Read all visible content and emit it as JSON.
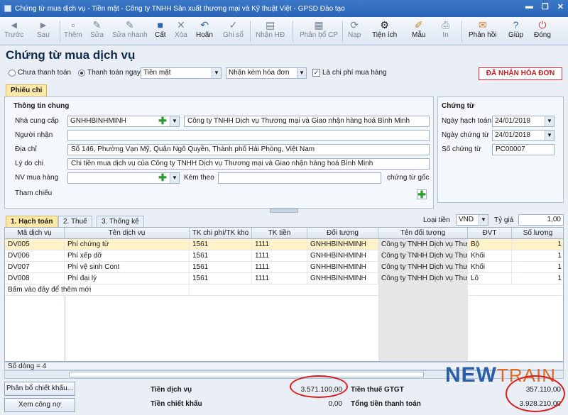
{
  "window": {
    "title": "Chứng từ mua dịch vụ - Tiền mặt - Công ty TNHH Sản xuất thương mại và Kỹ thuật Việt - GPSD Đào tạo",
    "controls": [
      "▬",
      "❐",
      "✕"
    ]
  },
  "toolbar": {
    "items": [
      {
        "label": "Trước",
        "icon": "◄"
      },
      {
        "label": "Sau",
        "icon": "►"
      },
      {
        "label": "Thêm",
        "icon": "▫"
      },
      {
        "label": "Sửa",
        "icon": "✎"
      },
      {
        "label": "Sửa nhanh",
        "icon": "✎"
      },
      {
        "label": "Cất",
        "icon": "■"
      },
      {
        "label": "Xóa",
        "icon": "✕"
      },
      {
        "label": "Hoãn",
        "icon": "↶"
      },
      {
        "label": "Ghi sổ",
        "icon": "✓"
      },
      {
        "label": "Nhận HĐ",
        "icon": "▤"
      },
      {
        "label": "Phân bổ CP",
        "icon": "▦"
      },
      {
        "label": "Nạp",
        "icon": "⟳"
      },
      {
        "label": "Tiện ích",
        "icon": "⚙"
      },
      {
        "label": "Mẫu",
        "icon": "✐"
      },
      {
        "label": "In",
        "icon": "⎙"
      },
      {
        "label": "Phản hồi",
        "icon": "✉"
      },
      {
        "label": "Giúp",
        "icon": "?"
      },
      {
        "label": "Đóng",
        "icon": "⏻"
      }
    ]
  },
  "page": {
    "title": "Chứng từ mua dịch vụ"
  },
  "payment": {
    "option_unpaid": "Chưa thanh toán",
    "option_paid": "Thanh toán ngay",
    "method": "Tiền mặt",
    "invoice_option": "Nhận kèm hóa đơn",
    "purchase_cost_label": "Là chi phí mua hàng",
    "invoice_button": "ĐÃ NHẬN HÓA ĐƠN"
  },
  "tabs": {
    "voucher": "Phiếu chi"
  },
  "general": {
    "title": "Thông tin chung",
    "supplier_label": "Nhà cung cấp",
    "supplier_code": "GNHHBINHMINH",
    "supplier_name": "Công ty TNHH Dịch vụ Thương mại và Giao nhận hàng hoá Bình Minh",
    "receiver_label": "Người nhận",
    "receiver": "",
    "address_label": "Địa chỉ",
    "address": "Số 146, Phường Vạn Mỹ, Quận Ngô Quyền, Thành phố Hải Phòng, Việt Nam",
    "reason_label": "Lý do chi",
    "reason": "Chi tiền mua dịch vụ của Công ty TNHH Dịch vụ Thương mại và Giao nhận hàng hoá Bình Minh",
    "staff_label": "NV mua hàng",
    "staff": "",
    "attach_label": "Kèm theo",
    "attach": "",
    "attach_suffix": "chứng từ gốc",
    "reference_label": "Tham chiếu"
  },
  "voucher": {
    "title": "Chứng từ",
    "post_date_label": "Ngày hạch toán",
    "post_date": "24/01/2018",
    "voucher_date_label": "Ngày chứng từ",
    "voucher_date": "24/01/2018",
    "voucher_no_label": "Số chứng từ",
    "voucher_no": "PC00007"
  },
  "detail_tabs": [
    "1. Hạch toán",
    "2. Thuế",
    "3. Thống kê"
  ],
  "currency": {
    "label": "Loại tiền",
    "value": "VND",
    "rate_label": "Tỷ giá",
    "rate": "1,00"
  },
  "grid": {
    "headers": [
      "Mã dịch vụ",
      "Tên dịch vụ",
      "TK chi phí/TK kho",
      "TK tiền",
      "Đối tượng",
      "Tên đối tượng",
      "ĐVT",
      "Số lượng"
    ],
    "rows": [
      [
        "DV005",
        "Phí chứng từ",
        "1561",
        "1111",
        "GNHHBINHMINH",
        "Công ty TNHH Dịch vụ Thư",
        "Bộ",
        "1"
      ],
      [
        "DV006",
        "Phí xếp dỡ",
        "1561",
        "1111",
        "GNHHBINHMINH",
        "Công ty TNHH Dịch vụ Thư",
        "Khối",
        "1"
      ],
      [
        "DV007",
        "Phí vệ sinh Cont",
        "1561",
        "1111",
        "GNHHBINHMINH",
        "Công ty TNHH Dịch vụ Thư",
        "Khối",
        "1"
      ],
      [
        "DV008",
        "Phí đại lý",
        "1561",
        "1111",
        "GNHHBINHMINH",
        "Công ty TNHH Dịch vụ Thư",
        "Lô",
        "1"
      ]
    ],
    "add_hint": "Bấm vào đây để thêm mới",
    "row_count": "Số dòng = 4"
  },
  "buttons": {
    "allocate": "Phân bổ chiết khấu...",
    "view_debt": "Xem công nợ"
  },
  "summary": {
    "service_label": "Tiền dịch vụ",
    "service_value": "3.571.100,00",
    "discount_label": "Tiền chiết khấu",
    "discount_value": "0,00",
    "vat_label": "Tiền thuế GTGT",
    "vat_value": "357.110,00",
    "total_label": "Tổng tiền thanh toán",
    "total_value": "3.928.210,00"
  },
  "logo": {
    "text_a": "NEW",
    "text_b": "TRAIN"
  },
  "colors": {
    "titlebar": "#2b64b6",
    "highlight_ring": "#d81f1f",
    "active_tab": "#ffe9a8"
  }
}
